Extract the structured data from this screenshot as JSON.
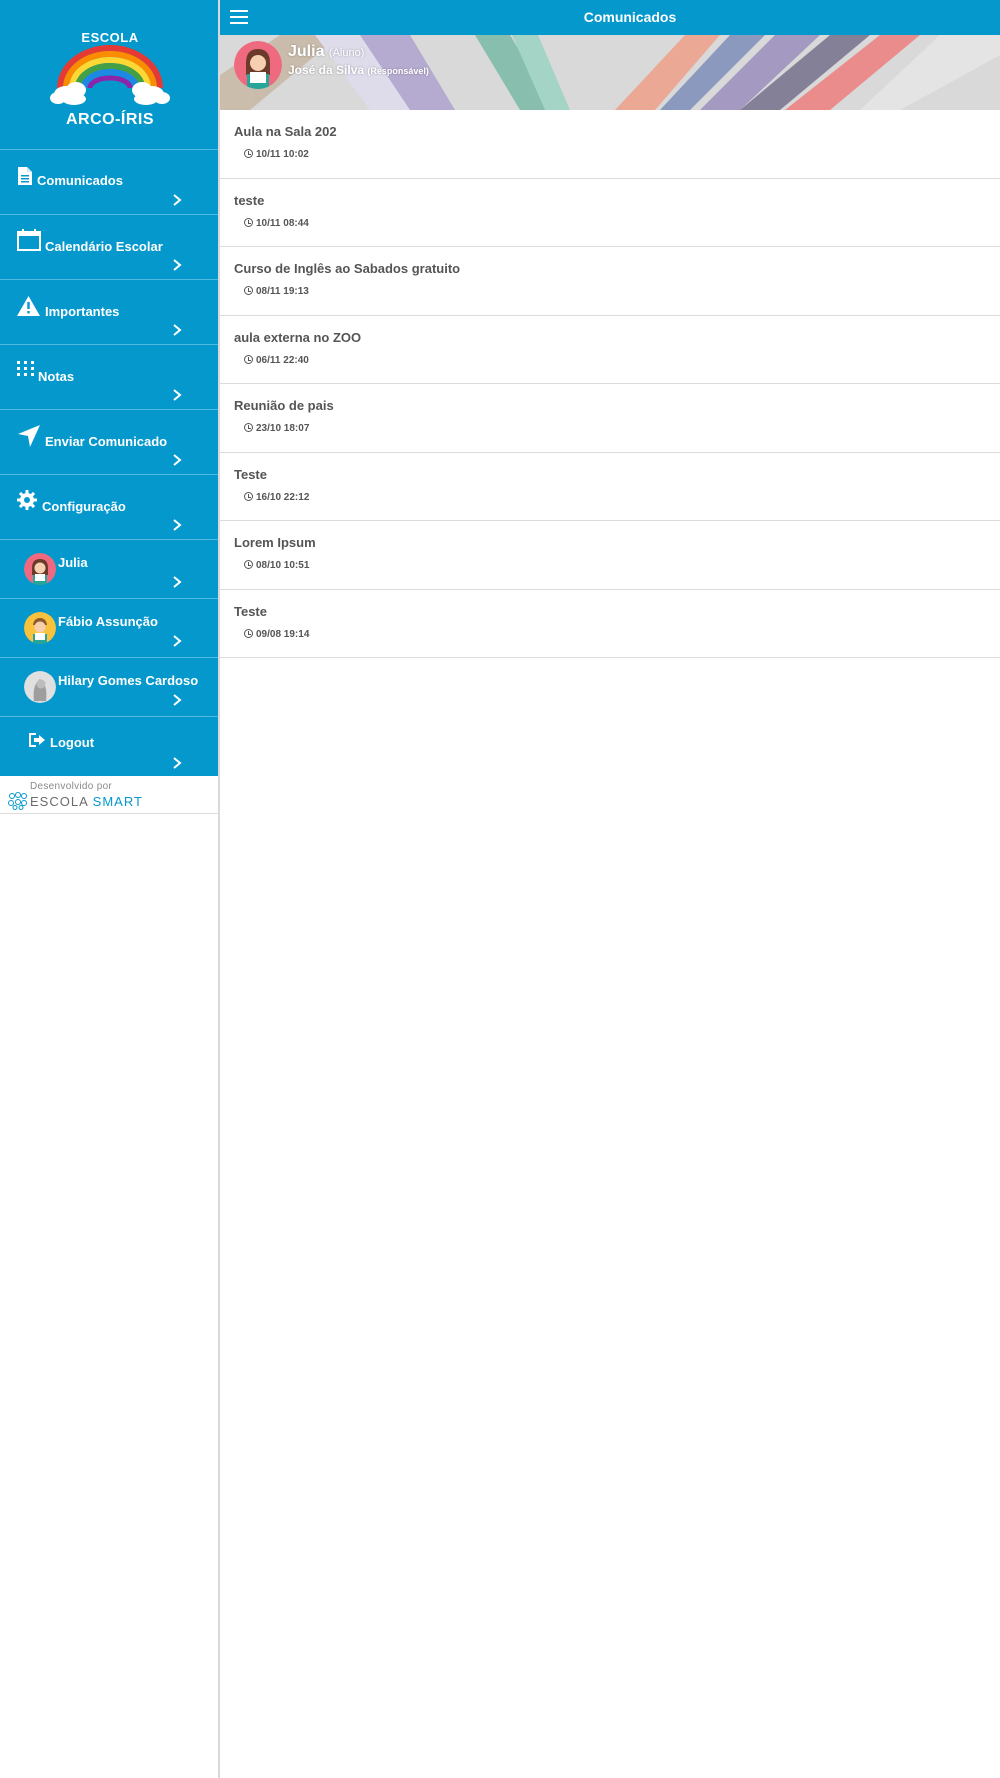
{
  "school": {
    "line1": "ESCOLA",
    "line2": "ARCO-ÍRIS"
  },
  "topbar": {
    "title": "Comunicados",
    "menu_icon": "hamburger-menu-icon"
  },
  "profile": {
    "name": "Julia",
    "name_role": "(Aluno)",
    "responsible": "José da Silva",
    "responsible_role": "(Responsável)"
  },
  "sidebar": {
    "menu": [
      {
        "label": "Comunicados",
        "icon": "document-icon"
      },
      {
        "label": "Calendário Escolar",
        "icon": "calendar-icon"
      },
      {
        "label": "Importantes",
        "icon": "warning-icon"
      },
      {
        "label": "Notas",
        "icon": "grid-icon"
      },
      {
        "label": "Enviar Comunicado",
        "icon": "send-icon"
      },
      {
        "label": "Configuração",
        "icon": "gear-icon"
      }
    ],
    "users": [
      {
        "label": "Julia"
      },
      {
        "label": "Fábio Assunção"
      },
      {
        "label": "Hilary Gomes Cardoso"
      }
    ],
    "logout": "Logout",
    "developed_by": "Desenvolvido por",
    "brand_a": "ESCOLA",
    "brand_b": "SMART"
  },
  "notices": [
    {
      "title": "Aula na Sala 202",
      "time": "10/11 10:02"
    },
    {
      "title": "teste",
      "time": "10/11 08:44"
    },
    {
      "title": "Curso de Inglês ao Sabados gratuito",
      "time": "08/11 19:13"
    },
    {
      "title": "aula externa no ZOO",
      "time": "06/11 22:40"
    },
    {
      "title": "Reunião de pais",
      "time": "23/10 18:07"
    },
    {
      "title": "Teste",
      "time": "16/10 22:12"
    },
    {
      "title": "Lorem Ipsum",
      "time": "08/10 10:51"
    },
    {
      "title": "Teste",
      "time": "09/08 19:14"
    }
  ],
  "colors": {
    "primary": "#0598cd",
    "text": "#555555"
  }
}
